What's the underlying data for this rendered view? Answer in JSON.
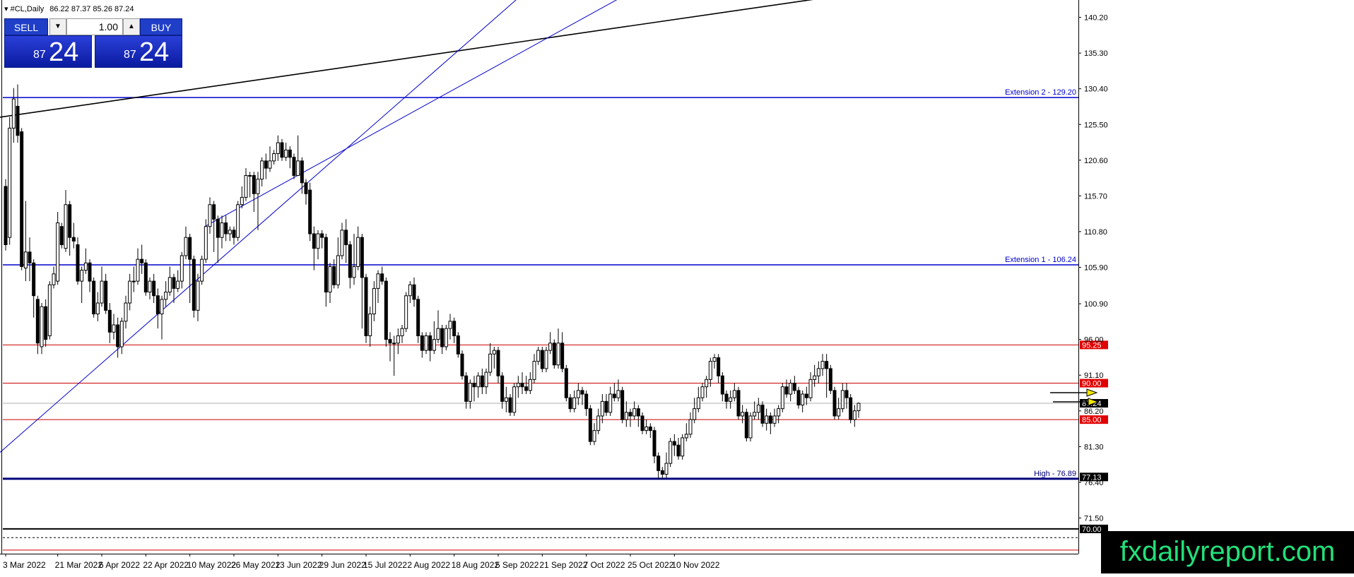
{
  "header": {
    "symbol_line": "#CL,Daily",
    "ohlc": "86.22 87.37 85.26 87.24"
  },
  "trade_panel": {
    "sell_label": "SELL",
    "buy_label": "BUY",
    "lot": "1.00",
    "sell_price_small": "87",
    "sell_price_big": "24",
    "buy_price_small": "87",
    "buy_price_big": "24",
    "down_icon": "triangle-down-icon",
    "up_icon": "triangle-up-icon"
  },
  "watermark": "fxdailyreport.com",
  "chart_data": {
    "type": "candlestick",
    "ylim": [
      66.6,
      142.0
    ],
    "y_ticks": [
      "140.20",
      "135.30",
      "130.40",
      "125.50",
      "120.60",
      "115.70",
      "110.80",
      "105.90",
      "100.90",
      "96.00",
      "91.10",
      "86.20",
      "81.30",
      "76.40",
      "71.50"
    ],
    "x_labels": [
      "3 Mar 2022",
      "21 Mar 2022",
      "6 Apr 2022",
      "22 Apr 2022",
      "10 May 2022",
      "26 May 2022",
      "13 Jun 2022",
      "29 Jun 2022",
      "15 Jul 2022",
      "2 Aug 2022",
      "18 Aug 2022",
      "5 Sep 2022",
      "21 Sep 2022",
      "7 Oct 2022",
      "25 Oct 2022",
      "10 Nov 2022"
    ],
    "horizontal_levels": [
      {
        "value": 129.2,
        "label": "Extension 2 - 129.20",
        "color": "#0000cc"
      },
      {
        "value": 106.24,
        "label": "Extension 1 - 106.24",
        "color": "#0000cc"
      },
      {
        "value": 95.25,
        "label": "95.25",
        "color": "#cc0000"
      },
      {
        "value": 90.0,
        "label": "90.00",
        "color": "#cc0000"
      },
      {
        "value": 85.0,
        "label": "85.00",
        "color": "#cc0000"
      },
      {
        "value": 76.89,
        "label": "High - 76.89",
        "color": "#00007a"
      },
      {
        "value": 70.0,
        "label": "70.00",
        "color": "#000000"
      }
    ],
    "price_tags": [
      {
        "value": 87.24,
        "label": "87.24"
      },
      {
        "value": 77.13,
        "label": "77.13"
      }
    ],
    "trendlines": [
      {
        "from": [
          0,
          126.5
        ],
        "to": [
          1175,
          143
        ],
        "color": "#000000"
      },
      {
        "from": [
          0,
          80.5
        ],
        "to": [
          735,
          143
        ],
        "color": "#0000cc"
      },
      {
        "from": [
          290,
          111.5
        ],
        "to": [
          880,
          143
        ],
        "color": "#0000cc"
      }
    ],
    "candles": [
      [
        117.0,
        109.0,
        118.0,
        108.2
      ],
      [
        110.0,
        125.0,
        126.5,
        109.0
      ],
      [
        125.0,
        129.0,
        130.5,
        123.0
      ],
      [
        128.0,
        124.0,
        131.0,
        123.0
      ],
      [
        124.5,
        106.0,
        125.0,
        105.5
      ],
      [
        105.8,
        108.0,
        115.0,
        104.0
      ],
      [
        108.0,
        106.5,
        110.0,
        104.0
      ],
      [
        106.5,
        102.0,
        107.0,
        99.0
      ],
      [
        101.5,
        95.5,
        102.0,
        94.0
      ],
      [
        95.0,
        100.5,
        101.0,
        94.0
      ],
      [
        100.5,
        96.0,
        101.5,
        95.0
      ],
      [
        96.5,
        103.5,
        104.0,
        96.0
      ],
      [
        103.5,
        105.0,
        106.0,
        103.0
      ],
      [
        104.0,
        112.0,
        113.5,
        103.5
      ],
      [
        111.5,
        109.0,
        112.0,
        108.5
      ],
      [
        108.5,
        114.5,
        116.5,
        108.0
      ],
      [
        114.5,
        110.0,
        115.0,
        107.5
      ],
      [
        110.0,
        109.5,
        112.0,
        108.5
      ],
      [
        109.0,
        104.0,
        110.0,
        103.5
      ],
      [
        104.0,
        105.5,
        106.0,
        101.0
      ],
      [
        105.5,
        106.5,
        108.5,
        105.0
      ],
      [
        106.5,
        104.0,
        107.0,
        102.5
      ],
      [
        104.0,
        99.5,
        104.5,
        99.0
      ],
      [
        99.5,
        101.0,
        102.5,
        98.5
      ],
      [
        101.0,
        104.0,
        106.0,
        100.5
      ],
      [
        104.0,
        100.0,
        105.0,
        99.5
      ],
      [
        100.0,
        97.0,
        101.0,
        95.5
      ],
      [
        97.0,
        98.0,
        99.5,
        96.0
      ],
      [
        98.0,
        95.0,
        99.0,
        93.5
      ],
      [
        95.0,
        98.5,
        99.0,
        94.0
      ],
      [
        98.5,
        101.0,
        102.0,
        97.5
      ],
      [
        101.0,
        104.0,
        105.0,
        100.0
      ],
      [
        104.0,
        104.0,
        106.0,
        102.5
      ],
      [
        104.0,
        107.0,
        108.5,
        103.5
      ],
      [
        107.0,
        106.5,
        109.0,
        105.0
      ],
      [
        106.5,
        102.5,
        107.0,
        102.0
      ],
      [
        102.5,
        104.0,
        104.5,
        101.5
      ],
      [
        104.0,
        102.0,
        105.0,
        101.0
      ],
      [
        102.0,
        99.5,
        103.0,
        97.5
      ],
      [
        99.5,
        101.5,
        102.0,
        96.0
      ],
      [
        101.5,
        102.5,
        104.0,
        100.5
      ],
      [
        102.5,
        104.5,
        106.0,
        102.0
      ],
      [
        104.5,
        103.0,
        105.0,
        101.0
      ],
      [
        103.0,
        104.0,
        105.5,
        102.5
      ],
      [
        104.0,
        107.5,
        108.0,
        103.0
      ],
      [
        107.5,
        110.0,
        111.5,
        107.0
      ],
      [
        110.0,
        107.0,
        110.5,
        101.0
      ],
      [
        107.0,
        100.0,
        107.5,
        99.0
      ],
      [
        100.0,
        104.0,
        105.0,
        98.5
      ],
      [
        104.0,
        107.0,
        107.5,
        103.5
      ],
      [
        107.0,
        111.5,
        112.5,
        106.5
      ],
      [
        111.5,
        114.5,
        115.5,
        110.5
      ],
      [
        114.5,
        112.5,
        115.0,
        108.0
      ],
      [
        112.5,
        110.0,
        113.0,
        106.5
      ],
      [
        110.0,
        112.0,
        113.0,
        108.5
      ],
      [
        112.0,
        110.5,
        113.0,
        109.5
      ],
      [
        110.5,
        111.0,
        111.5,
        109.5
      ],
      [
        111.0,
        110.0,
        111.5,
        109.0
      ],
      [
        110.0,
        114.5,
        115.0,
        109.5
      ],
      [
        114.5,
        115.5,
        117.0,
        114.0
      ],
      [
        115.5,
        118.5,
        119.5,
        115.0
      ],
      [
        118.5,
        118.5,
        119.0,
        115.5
      ],
      [
        118.5,
        116.0,
        119.0,
        113.5
      ],
      [
        116.0,
        118.0,
        119.0,
        111.0
      ],
      [
        118.0,
        120.5,
        121.0,
        117.0
      ],
      [
        120.5,
        119.5,
        121.5,
        118.0
      ],
      [
        119.5,
        120.5,
        122.5,
        119.0
      ],
      [
        120.5,
        121.5,
        122.0,
        120.0
      ],
      [
        121.5,
        123.0,
        124.0,
        120.5
      ],
      [
        123.0,
        121.0,
        123.5,
        120.5
      ],
      [
        121.0,
        122.0,
        123.0,
        120.5
      ],
      [
        122.0,
        121.0,
        122.5,
        119.5
      ],
      [
        121.0,
        118.5,
        121.5,
        118.0
      ],
      [
        118.5,
        120.5,
        124.0,
        118.5
      ],
      [
        120.5,
        117.5,
        121.0,
        116.0
      ],
      [
        117.5,
        116.0,
        118.0,
        114.5
      ],
      [
        116.5,
        110.5,
        117.5,
        109.5
      ],
      [
        110.5,
        108.5,
        111.5,
        105.5
      ],
      [
        108.5,
        110.5,
        111.0,
        107.0
      ],
      [
        110.5,
        110.0,
        111.0,
        108.5
      ],
      [
        110.0,
        102.5,
        110.5,
        100.5
      ],
      [
        102.5,
        106.0,
        106.5,
        101.0
      ],
      [
        106.0,
        103.5,
        107.0,
        103.0
      ],
      [
        103.5,
        107.5,
        110.0,
        103.0
      ],
      [
        107.5,
        111.0,
        112.0,
        107.0
      ],
      [
        111.0,
        109.0,
        112.5,
        106.5
      ],
      [
        109.0,
        104.5,
        109.5,
        103.0
      ],
      [
        104.5,
        106.0,
        110.5,
        103.5
      ],
      [
        106.0,
        110.0,
        111.5,
        105.5
      ],
      [
        110.0,
        104.5,
        110.5,
        97.5
      ],
      [
        104.5,
        96.5,
        105.0,
        95.5
      ],
      [
        96.5,
        99.5,
        100.5,
        95.0
      ],
      [
        99.5,
        103.0,
        104.0,
        98.5
      ],
      [
        103.0,
        105.0,
        105.5,
        101.0
      ],
      [
        105.0,
        104.0,
        106.0,
        103.5
      ],
      [
        104.0,
        96.0,
        104.5,
        95.0
      ],
      [
        96.0,
        95.5,
        97.0,
        93.0
      ],
      [
        95.5,
        95.5,
        96.5,
        91.0
      ],
      [
        95.5,
        96.5,
        97.5,
        94.0
      ],
      [
        96.5,
        97.5,
        98.0,
        95.5
      ],
      [
        97.5,
        102.0,
        102.5,
        97.0
      ],
      [
        102.0,
        103.5,
        104.0,
        101.0
      ],
      [
        103.5,
        101.5,
        104.5,
        100.5
      ],
      [
        101.5,
        96.5,
        102.0,
        95.5
      ],
      [
        96.5,
        94.5,
        97.0,
        93.5
      ],
      [
        94.5,
        96.5,
        97.0,
        94.0
      ],
      [
        96.5,
        94.5,
        97.0,
        93.0
      ],
      [
        94.5,
        96.0,
        98.5,
        94.0
      ],
      [
        96.0,
        97.5,
        100.0,
        95.5
      ],
      [
        97.5,
        95.0,
        98.0,
        94.0
      ],
      [
        95.0,
        97.5,
        98.0,
        94.5
      ],
      [
        97.5,
        98.5,
        99.5,
        96.0
      ],
      [
        98.5,
        96.5,
        99.0,
        95.5
      ],
      [
        96.5,
        94.0,
        97.0,
        93.5
      ],
      [
        94.0,
        91.0,
        94.5,
        90.5
      ],
      [
        91.0,
        87.5,
        91.5,
        86.5
      ],
      [
        87.5,
        90.0,
        90.5,
        86.5
      ],
      [
        90.0,
        89.5,
        91.0,
        87.5
      ],
      [
        89.5,
        91.0,
        91.5,
        88.0
      ],
      [
        91.0,
        89.5,
        92.0,
        88.5
      ],
      [
        89.5,
        91.5,
        92.0,
        88.5
      ],
      [
        91.5,
        94.0,
        95.5,
        91.0
      ],
      [
        94.0,
        94.5,
        95.0,
        92.0
      ],
      [
        94.5,
        91.0,
        95.0,
        90.0
      ],
      [
        91.0,
        87.5,
        91.5,
        86.5
      ],
      [
        87.5,
        88.0,
        89.5,
        86.0
      ],
      [
        88.0,
        86.0,
        88.5,
        85.5
      ],
      [
        86.0,
        89.5,
        90.0,
        85.5
      ],
      [
        89.5,
        90.0,
        91.0,
        88.0
      ],
      [
        90.0,
        89.5,
        91.5,
        88.5
      ],
      [
        89.5,
        89.0,
        91.0,
        88.5
      ],
      [
        89.0,
        90.5,
        91.5,
        88.5
      ],
      [
        90.5,
        93.0,
        94.0,
        90.0
      ],
      [
        93.0,
        94.5,
        95.0,
        92.5
      ],
      [
        94.5,
        92.0,
        95.0,
        91.5
      ],
      [
        92.0,
        94.5,
        95.0,
        91.5
      ],
      [
        94.5,
        95.5,
        97.0,
        94.0
      ],
      [
        95.5,
        92.5,
        96.0,
        92.0
      ],
      [
        92.5,
        95.5,
        97.5,
        92.0
      ],
      [
        95.5,
        92.0,
        97.0,
        91.5
      ],
      [
        92.0,
        88.0,
        92.5,
        87.5
      ],
      [
        88.0,
        86.5,
        88.5,
        86.0
      ],
      [
        86.5,
        88.0,
        89.0,
        86.0
      ],
      [
        88.0,
        89.0,
        90.0,
        87.0
      ],
      [
        89.0,
        88.5,
        89.5,
        87.0
      ],
      [
        88.5,
        86.5,
        89.0,
        85.5
      ],
      [
        86.5,
        82.0,
        87.0,
        81.5
      ],
      [
        82.0,
        83.5,
        84.5,
        81.5
      ],
      [
        83.5,
        85.5,
        86.5,
        83.0
      ],
      [
        85.5,
        87.5,
        88.5,
        84.5
      ],
      [
        87.5,
        86.0,
        88.5,
        85.5
      ],
      [
        86.0,
        88.5,
        89.5,
        85.5
      ],
      [
        88.5,
        88.0,
        90.0,
        87.5
      ],
      [
        88.0,
        89.0,
        90.5,
        87.5
      ],
      [
        89.0,
        85.0,
        89.5,
        84.5
      ],
      [
        85.0,
        86.0,
        87.5,
        84.0
      ],
      [
        86.0,
        85.5,
        86.5,
        84.0
      ],
      [
        85.5,
        86.5,
        87.5,
        85.0
      ],
      [
        86.5,
        85.5,
        87.0,
        84.0
      ],
      [
        85.5,
        83.5,
        86.0,
        83.0
      ],
      [
        83.5,
        84.0,
        85.0,
        83.0
      ],
      [
        84.0,
        83.5,
        84.5,
        82.5
      ],
      [
        83.5,
        80.0,
        84.0,
        79.0
      ],
      [
        80.0,
        78.0,
        80.5,
        76.9
      ],
      [
        78.0,
        77.5,
        78.5,
        76.9
      ],
      [
        77.5,
        79.0,
        80.5,
        77.0
      ],
      [
        79.0,
        82.0,
        82.5,
        78.5
      ],
      [
        82.0,
        81.5,
        83.0,
        80.0
      ],
      [
        81.5,
        80.0,
        82.5,
        79.5
      ],
      [
        80.0,
        82.5,
        83.0,
        79.5
      ],
      [
        82.5,
        83.0,
        84.5,
        82.0
      ],
      [
        83.0,
        85.0,
        86.0,
        82.5
      ],
      [
        85.0,
        86.5,
        88.0,
        84.5
      ],
      [
        86.5,
        88.0,
        89.5,
        86.0
      ],
      [
        88.0,
        89.5,
        90.0,
        87.5
      ],
      [
        89.5,
        90.5,
        91.0,
        88.0
      ],
      [
        90.5,
        93.0,
        93.5,
        89.5
      ],
      [
        93.0,
        93.5,
        94.0,
        92.0
      ],
      [
        93.5,
        91.0,
        94.0,
        90.0
      ],
      [
        91.0,
        88.5,
        91.5,
        87.5
      ],
      [
        88.5,
        87.5,
        89.0,
        86.5
      ],
      [
        87.5,
        88.0,
        89.0,
        86.5
      ],
      [
        88.0,
        89.0,
        90.0,
        87.5
      ],
      [
        89.0,
        85.5,
        89.5,
        85.0
      ],
      [
        85.5,
        86.0,
        87.0,
        84.5
      ],
      [
        86.0,
        82.5,
        86.5,
        82.0
      ],
      [
        82.5,
        85.5,
        86.0,
        82.0
      ],
      [
        85.5,
        86.0,
        87.5,
        85.0
      ],
      [
        86.0,
        87.0,
        88.0,
        85.0
      ],
      [
        87.0,
        84.5,
        87.5,
        84.0
      ],
      [
        84.5,
        85.5,
        86.5,
        83.5
      ],
      [
        85.5,
        84.5,
        86.0,
        83.0
      ],
      [
        84.5,
        85.5,
        86.5,
        84.0
      ],
      [
        85.5,
        86.5,
        87.0,
        84.5
      ],
      [
        86.5,
        89.5,
        90.0,
        86.0
      ],
      [
        89.5,
        88.5,
        90.5,
        88.0
      ],
      [
        88.5,
        90.0,
        90.5,
        87.5
      ],
      [
        90.0,
        89.0,
        91.0,
        88.5
      ],
      [
        89.0,
        87.0,
        89.5,
        86.5
      ],
      [
        87.0,
        88.5,
        89.0,
        86.0
      ],
      [
        88.5,
        88.0,
        89.5,
        87.0
      ],
      [
        88.0,
        90.5,
        91.5,
        87.5
      ],
      [
        90.5,
        91.0,
        92.5,
        89.5
      ],
      [
        91.0,
        92.0,
        93.0,
        90.0
      ],
      [
        92.0,
        93.0,
        94.0,
        91.0
      ],
      [
        93.0,
        92.0,
        94.0,
        88.0
      ],
      [
        92.0,
        89.0,
        92.5,
        88.5
      ],
      [
        89.0,
        85.5,
        89.5,
        85.0
      ],
      [
        85.5,
        86.5,
        88.0,
        85.0
      ],
      [
        86.5,
        89.0,
        90.0,
        86.0
      ],
      [
        89.0,
        88.0,
        90.0,
        86.5
      ],
      [
        88.0,
        85.0,
        88.5,
        84.5
      ],
      [
        85.0,
        86.2,
        87.0,
        84.0
      ],
      [
        86.22,
        87.24,
        87.37,
        85.26
      ]
    ],
    "last_price": 87.24
  }
}
